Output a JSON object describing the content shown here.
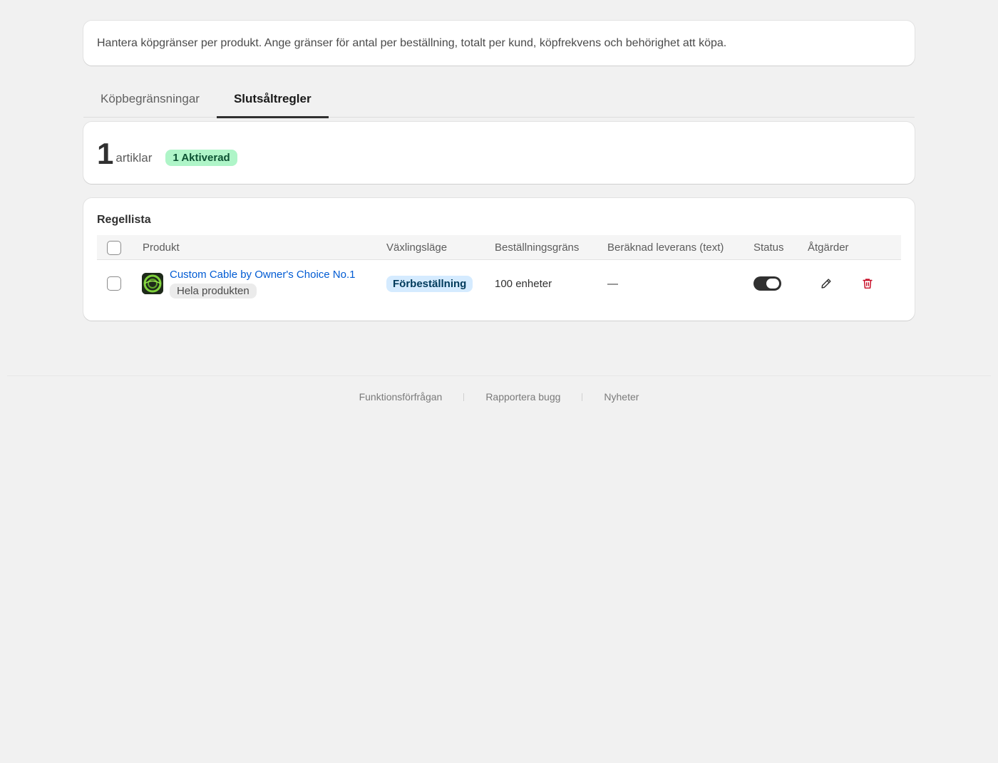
{
  "intro": {
    "text": "Hantera köpgränser per produkt. Ange gränser för antal per beställning, totalt per kund, köpfrekvens och behörighet att köpa."
  },
  "tabs": [
    {
      "label": "Köpbegränsningar",
      "active": false
    },
    {
      "label": "Slutsåltregler",
      "active": true
    }
  ],
  "summary": {
    "count": "1",
    "count_label": "artiklar",
    "active_badge": "1 Aktiverad"
  },
  "rules": {
    "title": "Regellista",
    "columns": [
      "Produkt",
      "Växlingsläge",
      "Beställningsgräns",
      "Beräknad leverans (text)",
      "Status",
      "Åtgärder"
    ],
    "rows": [
      {
        "product_name": "Custom Cable by Owner's Choice No.1",
        "product_scope": "Hela produkten",
        "mode": "Förbeställning",
        "limit": "100 enheter",
        "delivery_text": "—",
        "status_on": true
      }
    ]
  },
  "footer": {
    "links": [
      "Funktionsförfrågan",
      "Rapportera bugg",
      "Nyheter"
    ]
  },
  "colors": {
    "background": "#f1f1f1",
    "link": "#005bd3",
    "badge_green_bg": "#aff5c8",
    "badge_blue_bg": "#d5ebff",
    "delete_red": "#c70a24"
  },
  "icons": [
    "pencil-icon",
    "trash-icon"
  ]
}
